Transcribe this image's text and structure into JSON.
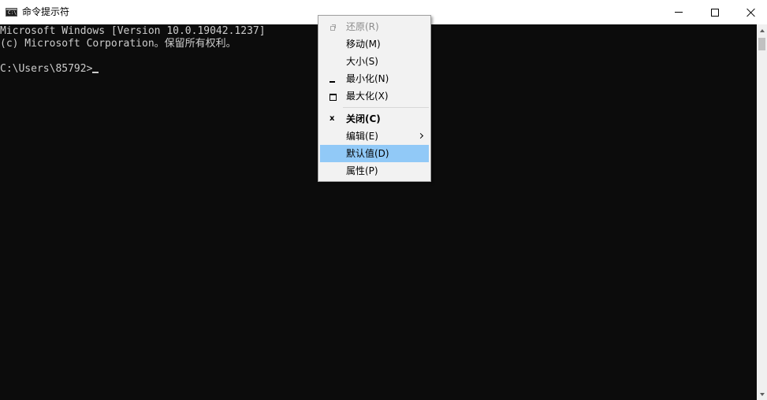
{
  "window": {
    "title": "命令提示符",
    "app_icon": "cmd-icon",
    "app_icon_text": "C:\\"
  },
  "controls": {
    "minimize_icon": "minimize-icon",
    "maximize_icon": "maximize-icon",
    "close_icon": "close-icon"
  },
  "console": {
    "line1": "Microsoft Windows [Version 10.0.19042.1237]",
    "line2": "(c) Microsoft Corporation。保留所有权利。",
    "prompt": "C:\\Users\\85792>"
  },
  "menu": {
    "items": [
      {
        "label": "还原(R)",
        "icon": "restore-icon",
        "enabled": false
      },
      {
        "label": "移动(M)",
        "icon": "",
        "enabled": true
      },
      {
        "label": "大小(S)",
        "icon": "",
        "enabled": true
      },
      {
        "label": "最小化(N)",
        "icon": "minimize-icon",
        "enabled": true
      },
      {
        "label": "最大化(X)",
        "icon": "maximize-icon",
        "enabled": true
      },
      {
        "label": "关闭(C)",
        "icon": "close-icon",
        "icon_text": "x",
        "enabled": true,
        "bold": true
      },
      {
        "label": "编辑(E)",
        "icon": "",
        "enabled": true,
        "submenu": true
      },
      {
        "label": "默认值(D)",
        "icon": "",
        "enabled": true,
        "highlighted": true
      },
      {
        "label": "属性(P)",
        "icon": "",
        "enabled": true
      }
    ]
  },
  "colors": {
    "console_bg": "#0c0c0c",
    "console_fg": "#cccccc",
    "menu_bg": "#f2f2f2",
    "menu_highlight": "#91c9f7",
    "disabled_text": "#8c8c8c"
  }
}
